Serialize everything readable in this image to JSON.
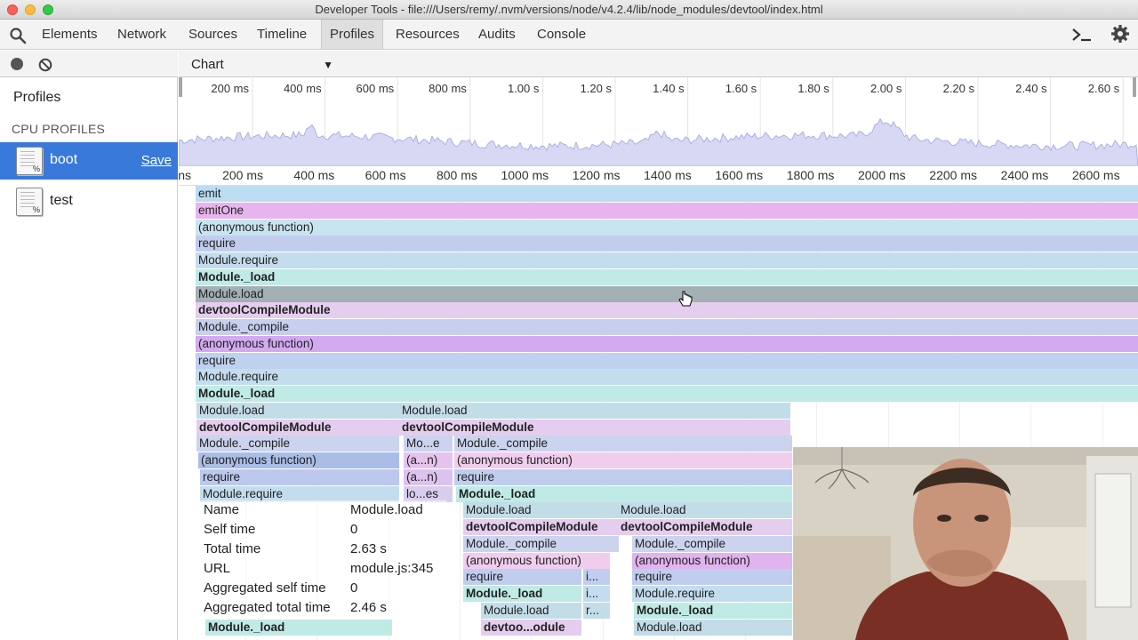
{
  "window": {
    "title": "Developer Tools - file:///Users/remy/.nvm/versions/node/v4.2.4/lib/node_modules/devtool/index.html"
  },
  "tabs": [
    "Elements",
    "Network",
    "Sources",
    "Timeline",
    "Profiles",
    "Resources",
    "Audits",
    "Console"
  ],
  "active_tab": "Profiles",
  "toolbar": {
    "view": "Chart"
  },
  "sidebar": {
    "heading": "Profiles",
    "section": "CPU PROFILES",
    "items": [
      {
        "name": "boot",
        "action": "Save",
        "selected": true
      },
      {
        "name": "test",
        "selected": false
      }
    ]
  },
  "overview": {
    "ticks": [
      "200 ms",
      "400 ms",
      "600 ms",
      "800 ms",
      "1.00 s",
      "1.20 s",
      "1.40 s",
      "1.60 s",
      "1.80 s",
      "2.00 s",
      "2.20 s",
      "2.40 s",
      "2.60 s"
    ]
  },
  "ruler": {
    "first_partial": "ns",
    "ticks": [
      "200 ms",
      "400 ms",
      "600 ms",
      "800 ms",
      "1000 ms",
      "1200 ms",
      "1400 ms",
      "1600 ms",
      "1800 ms",
      "2000 ms",
      "2200 ms",
      "2400 ms",
      "2600 ms"
    ]
  },
  "flame": {
    "full_width_rows": [
      {
        "label": "emit",
        "color": "#bcdcf2"
      },
      {
        "label": "emitOne",
        "color": "#e7b4ef"
      },
      {
        "label": "(anonymous function)",
        "color": "#c8e4f1"
      },
      {
        "label": "require",
        "color": "#c2cdee"
      },
      {
        "label": "Module.require",
        "color": "#c3ddee"
      },
      {
        "label": "Module._load",
        "color": "#bfeae6",
        "bold": true
      },
      {
        "label": "Module.load",
        "color": "#a3b0b4",
        "hover": true
      },
      {
        "label": "devtoolCompileModule",
        "color": "#e4cdee",
        "bold": true
      },
      {
        "label": "Module._compile",
        "color": "#c6d0ee"
      },
      {
        "label": "(anonymous function)",
        "color": "#d3a9f0"
      },
      {
        "label": "require",
        "color": "#bfd1f0"
      },
      {
        "label": "Module.require",
        "color": "#c3ddee"
      },
      {
        "label": "Module._load",
        "color": "#bfeae6",
        "bold": true
      }
    ],
    "blocks": [
      {
        "row": 13,
        "l": 20,
        "w": 228,
        "label": "Module.load",
        "color": "#c2dde8"
      },
      {
        "row": 13,
        "l": 248,
        "w": 440,
        "label": "Module.load",
        "color": "#c2dde8"
      },
      {
        "row": 14,
        "l": 20,
        "w": 228,
        "label": "devtoolCompileModule",
        "color": "#e4cdee",
        "bold": true
      },
      {
        "row": 14,
        "l": 248,
        "w": 440,
        "label": "devtoolCompileModule",
        "color": "#e4cdee",
        "bold": true
      },
      {
        "row": 15,
        "l": 20,
        "w": 228,
        "label": "Module._compile",
        "color": "#cbd3ee"
      },
      {
        "row": 15,
        "l": 253,
        "w": 55,
        "label": "Mo...e",
        "color": "#cbd3ee"
      },
      {
        "row": 15,
        "l": 310,
        "w": 380,
        "label": "Module._compile",
        "color": "#cbd3ee"
      },
      {
        "row": 16,
        "l": 22,
        "w": 226,
        "label": "(anonymous function)",
        "color": "#a9bde6"
      },
      {
        "row": 16,
        "l": 253,
        "w": 55,
        "label": "(a...n)",
        "color": "#e6c2ef"
      },
      {
        "row": 16,
        "l": 310,
        "w": 380,
        "label": "(anonymous function)",
        "color": "#f0cdee"
      },
      {
        "row": 17,
        "l": 24,
        "w": 224,
        "label": "require",
        "color": "#bcc8ee"
      },
      {
        "row": 17,
        "l": 253,
        "w": 55,
        "label": "(a...n)",
        "color": "#dcc3ef"
      },
      {
        "row": 17,
        "l": 310,
        "w": 380,
        "label": "require",
        "color": "#c0cdef"
      },
      {
        "row": 18,
        "l": 24,
        "w": 224,
        "label": "Module.require",
        "color": "#c3ddee"
      },
      {
        "row": 18,
        "l": 253,
        "w": 55,
        "label": "lo...es",
        "color": "#d8cdee"
      },
      {
        "row": 18,
        "l": 312,
        "w": 378,
        "label": "Module._load",
        "color": "#bfeae6",
        "bold": true
      },
      {
        "row": 19,
        "l": 320,
        "w": 175,
        "label": "Module.load",
        "color": "#c2dde8"
      },
      {
        "row": 19,
        "l": 494,
        "w": 196,
        "label": "Module.load",
        "color": "#c2dde8"
      },
      {
        "row": 20,
        "l": 320,
        "w": 175,
        "label": "devtoolCompileModule",
        "color": "#e4cdee",
        "bold": true
      },
      {
        "row": 20,
        "l": 494,
        "w": 196,
        "label": "devtoolCompileModule",
        "color": "#e4cdee",
        "bold": true
      },
      {
        "row": 21,
        "l": 320,
        "w": 175,
        "label": "Module._compile",
        "color": "#cbd3ee"
      },
      {
        "row": 21,
        "l": 510,
        "w": 180,
        "label": "Module._compile",
        "color": "#cbd3ee"
      },
      {
        "row": 22,
        "l": 320,
        "w": 165,
        "label": "(anonymous function)",
        "color": "#f0cdee"
      },
      {
        "row": 22,
        "l": 510,
        "w": 180,
        "label": "(anonymous function)",
        "color": "#e1b3ef"
      },
      {
        "row": 23,
        "l": 320,
        "w": 133,
        "label": "require",
        "color": "#c0cdef"
      },
      {
        "row": 23,
        "l": 455,
        "w": 30,
        "label": "i...",
        "color": "#c0cdef"
      },
      {
        "row": 23,
        "l": 510,
        "w": 180,
        "label": "require",
        "color": "#c0cdef"
      },
      {
        "row": 24,
        "l": 320,
        "w": 133,
        "label": "Module._load",
        "color": "#bfeae6",
        "bold": true
      },
      {
        "row": 24,
        "l": 455,
        "w": 30,
        "label": "i...",
        "color": "#c3ddee"
      },
      {
        "row": 24,
        "l": 510,
        "w": 180,
        "label": "Module.require",
        "color": "#c3ddee"
      },
      {
        "row": 25,
        "l": 340,
        "w": 113,
        "label": "Module.load",
        "color": "#c2dde8"
      },
      {
        "row": 25,
        "l": 455,
        "w": 30,
        "label": "r...",
        "color": "#c2dde8"
      },
      {
        "row": 25,
        "l": 512,
        "w": 178,
        "label": "Module._load",
        "color": "#bfeae6",
        "bold": true
      },
      {
        "row": 26,
        "l": 340,
        "w": 113,
        "label": "devtoo...odule",
        "color": "#e4cdee",
        "bold": true
      },
      {
        "row": 26,
        "l": 512,
        "w": 178,
        "label": "Module.load",
        "color": "#c2dde8"
      },
      {
        "row": 26,
        "l": 30,
        "w": 210,
        "label": "Module._load",
        "color": "#bfeae6",
        "bold": true
      }
    ]
  },
  "tooltip": {
    "rows": [
      {
        "label": "Name",
        "value": "Module.load"
      },
      {
        "label": "Self time",
        "value": "0"
      },
      {
        "label": "Total time",
        "value": "2.63 s"
      },
      {
        "label": "URL",
        "value": "module.js:345"
      },
      {
        "label": "Aggregated self time",
        "value": "0"
      },
      {
        "label": "Aggregated total time",
        "value": "2.46 s"
      }
    ]
  },
  "colors": {
    "selection": "#3879d9",
    "overview_fill": "#d6d8f4",
    "overview_stroke": "#a0a4dc"
  }
}
